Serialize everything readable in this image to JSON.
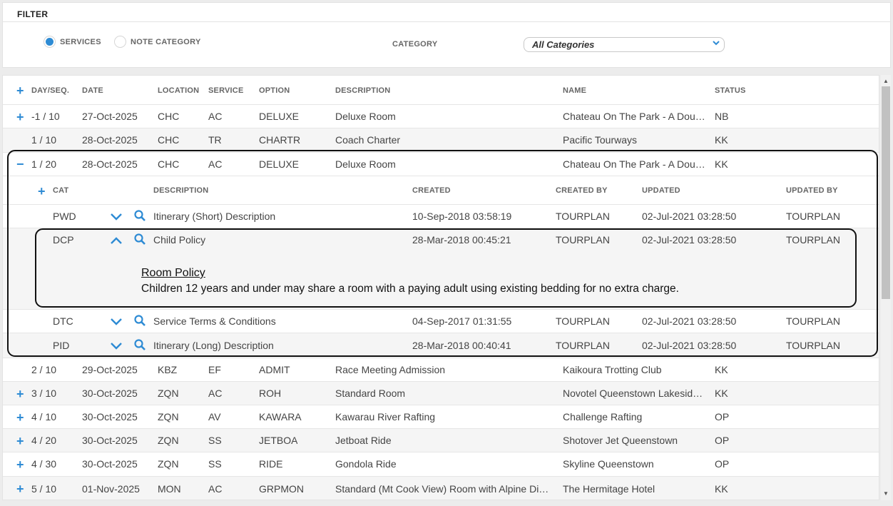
{
  "filter": {
    "title": "FILTER",
    "radio_services": "SERVICES",
    "radio_note_category": "NOTE CATEGORY",
    "category_label": "CATEGORY",
    "category_value": "All Categories"
  },
  "grid": {
    "headers": {
      "day_seq": "DAY/SEQ.",
      "date": "DATE",
      "location": "LOCATION",
      "service": "SERVICE",
      "option": "OPTION",
      "description": "DESCRIPTION",
      "name": "NAME",
      "status": "STATUS"
    },
    "rows": [
      {
        "day": "-1 / 10",
        "date": "27-Oct-2025",
        "loc": "CHC",
        "svc": "AC",
        "opt": "DELUXE",
        "desc": "Deluxe Room",
        "name": "Chateau On The Park - A Dou…",
        "status": "NB"
      },
      {
        "day": "1 / 10",
        "date": "28-Oct-2025",
        "loc": "CHC",
        "svc": "TR",
        "opt": "CHARTR",
        "desc": "Coach Charter",
        "name": "Pacific Tourways",
        "status": "KK"
      },
      {
        "day": "1 / 20",
        "date": "28-Oct-2025",
        "loc": "CHC",
        "svc": "AC",
        "opt": "DELUXE",
        "desc": "Deluxe Room",
        "name": "Chateau On The Park - A Dou…",
        "status": "KK"
      },
      {
        "day": "2 / 10",
        "date": "29-Oct-2025",
        "loc": "KBZ",
        "svc": "EF",
        "opt": "ADMIT",
        "desc": "Race Meeting Admission",
        "name": "Kaikoura Trotting Club",
        "status": "KK"
      },
      {
        "day": "3 / 10",
        "date": "30-Oct-2025",
        "loc": "ZQN",
        "svc": "AC",
        "opt": "ROH",
        "desc": "Standard Room",
        "name": "Novotel Queenstown Lakesid…",
        "status": "KK"
      },
      {
        "day": "4 / 10",
        "date": "30-Oct-2025",
        "loc": "ZQN",
        "svc": "AV",
        "opt": "KAWARA",
        "desc": "Kawarau River Rafting",
        "name": "Challenge Rafting",
        "status": "OP"
      },
      {
        "day": "4 / 20",
        "date": "30-Oct-2025",
        "loc": "ZQN",
        "svc": "SS",
        "opt": "JETBOA",
        "desc": "Jetboat Ride",
        "name": "Shotover Jet Queenstown",
        "status": "OP"
      },
      {
        "day": "4 / 30",
        "date": "30-Oct-2025",
        "loc": "ZQN",
        "svc": "SS",
        "opt": "RIDE",
        "desc": "Gondola Ride",
        "name": "Skyline Queenstown",
        "status": "OP"
      },
      {
        "day": "5 / 10",
        "date": "01-Nov-2025",
        "loc": "MON",
        "svc": "AC",
        "opt": "GRPMON",
        "desc": "Standard (Mt Cook View) Room with Alpine Di…",
        "name": "The Hermitage Hotel",
        "status": "KK"
      }
    ]
  },
  "notes": {
    "headers": {
      "cat": "CAT",
      "description": "DESCRIPTION",
      "created": "CREATED",
      "created_by": "CREATED BY",
      "updated": "UPDATED",
      "updated_by": "UPDATED BY"
    },
    "rows": [
      {
        "cat": "PWD",
        "desc": "Itinerary (Short) Description",
        "created": "10-Sep-2018 03:58:19",
        "created_by": "TOURPLAN",
        "updated": "02-Jul-2021 03:28:50",
        "updated_by": "TOURPLAN"
      },
      {
        "cat": "DCP",
        "desc": "Child Policy",
        "created": "28-Mar-2018 00:45:21",
        "created_by": "TOURPLAN",
        "updated": "02-Jul-2021 03:28:50",
        "updated_by": "TOURPLAN"
      },
      {
        "cat": "DTC",
        "desc": "Service Terms & Conditions",
        "created": "04-Sep-2017 01:31:55",
        "created_by": "TOURPLAN",
        "updated": "02-Jul-2021 03:28:50",
        "updated_by": "TOURPLAN"
      },
      {
        "cat": "PID",
        "desc": "Itinerary (Long) Description",
        "created": "28-Mar-2018 00:40:41",
        "created_by": "TOURPLAN",
        "updated": "02-Jul-2021 03:28:50",
        "updated_by": "TOURPLAN"
      }
    ],
    "expanded": {
      "title": "Room Policy",
      "text": "Children 12 years and under may share a room with a paying adult using existing bedding for no extra charge."
    }
  },
  "colors": {
    "accent": "#2e8bd4",
    "alt_row": "#f5f5f5"
  }
}
